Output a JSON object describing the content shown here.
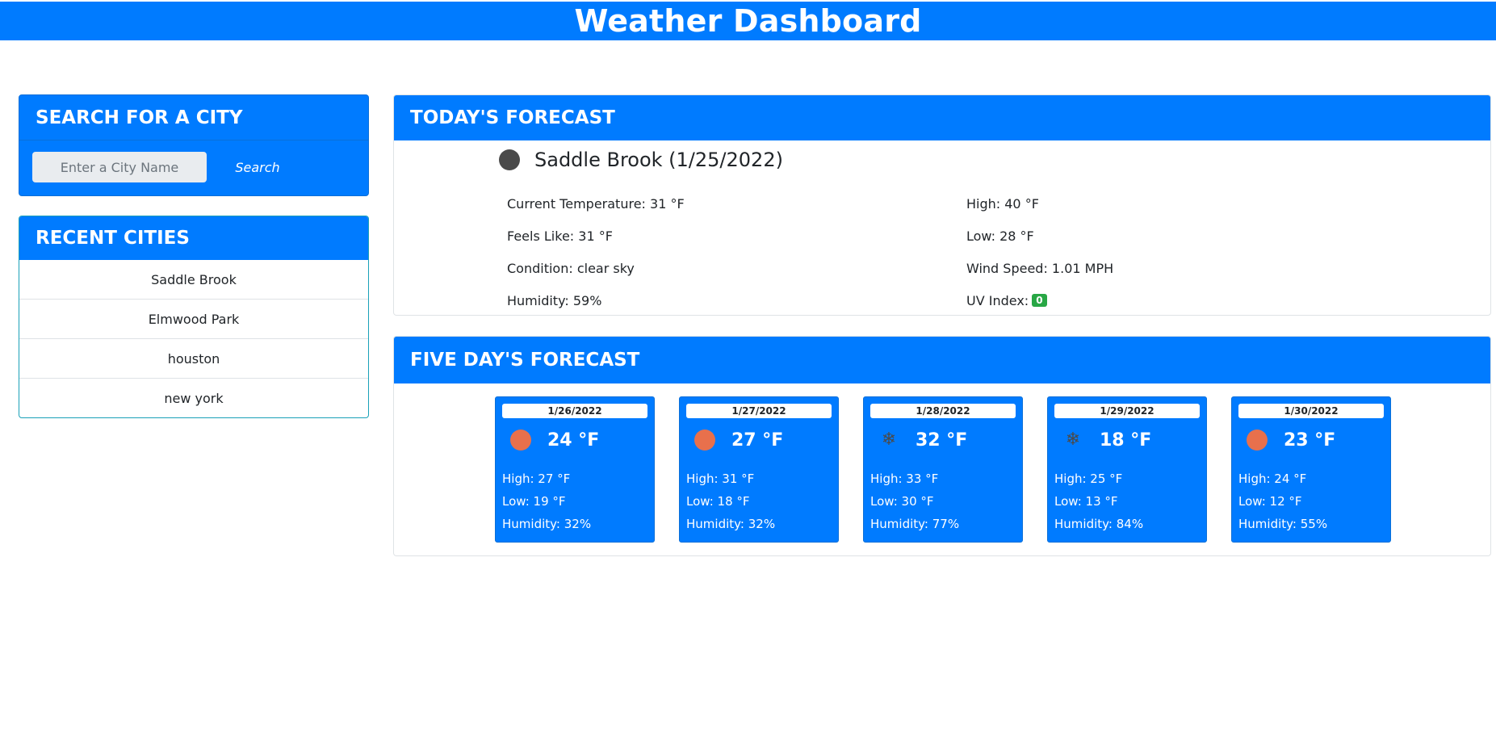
{
  "header": {
    "title": "Weather Dashboard"
  },
  "search": {
    "title": "SEARCH FOR A CITY",
    "placeholder": "Enter a City Name",
    "button_label": "Search"
  },
  "recent": {
    "title": "RECENT CITIES",
    "cities": [
      "Saddle Brook",
      "Elmwood Park",
      "houston",
      "new york"
    ]
  },
  "today": {
    "title": "TODAY'S FORECAST",
    "city_heading": "Saddle Brook (1/25/2022)",
    "icon": "dark-circle-icon",
    "current_temp": "Current Temperature: 31 °F",
    "high": "High: 40 °F",
    "feels_like": "Feels Like: 31 °F",
    "low": "Low: 28 °F",
    "condition": "Condition: clear sky",
    "wind": "Wind Speed: 1.01 MPH",
    "humidity": "Humidity: 59%",
    "uv_label": "UV Index:",
    "uv_value": "0",
    "uv_color": "#28a745"
  },
  "five_day": {
    "title": "FIVE DAY'S FORECAST",
    "days": [
      {
        "date": "1/26/2022",
        "icon": "sun-icon",
        "temp": "24 °F",
        "high": "High: 27 °F",
        "low": "Low: 19 °F",
        "humidity": "Humidity: 32%"
      },
      {
        "date": "1/27/2022",
        "icon": "sun-icon",
        "temp": "27 °F",
        "high": "High: 31 °F",
        "low": "Low: 18 °F",
        "humidity": "Humidity: 32%"
      },
      {
        "date": "1/28/2022",
        "icon": "snowflake-icon",
        "temp": "32 °F",
        "high": "High: 33 °F",
        "low": "Low: 30 °F",
        "humidity": "Humidity: 77%"
      },
      {
        "date": "1/29/2022",
        "icon": "snowflake-icon",
        "temp": "18 °F",
        "high": "High: 25 °F",
        "low": "Low: 13 °F",
        "humidity": "Humidity: 84%"
      },
      {
        "date": "1/30/2022",
        "icon": "sun-icon",
        "temp": "23 °F",
        "high": "High: 24 °F",
        "low": "Low: 12 °F",
        "humidity": "Humidity: 55%"
      }
    ]
  },
  "colors": {
    "primary": "#007bff",
    "sun": "#e8704c",
    "uv_badge": "#28a745"
  }
}
